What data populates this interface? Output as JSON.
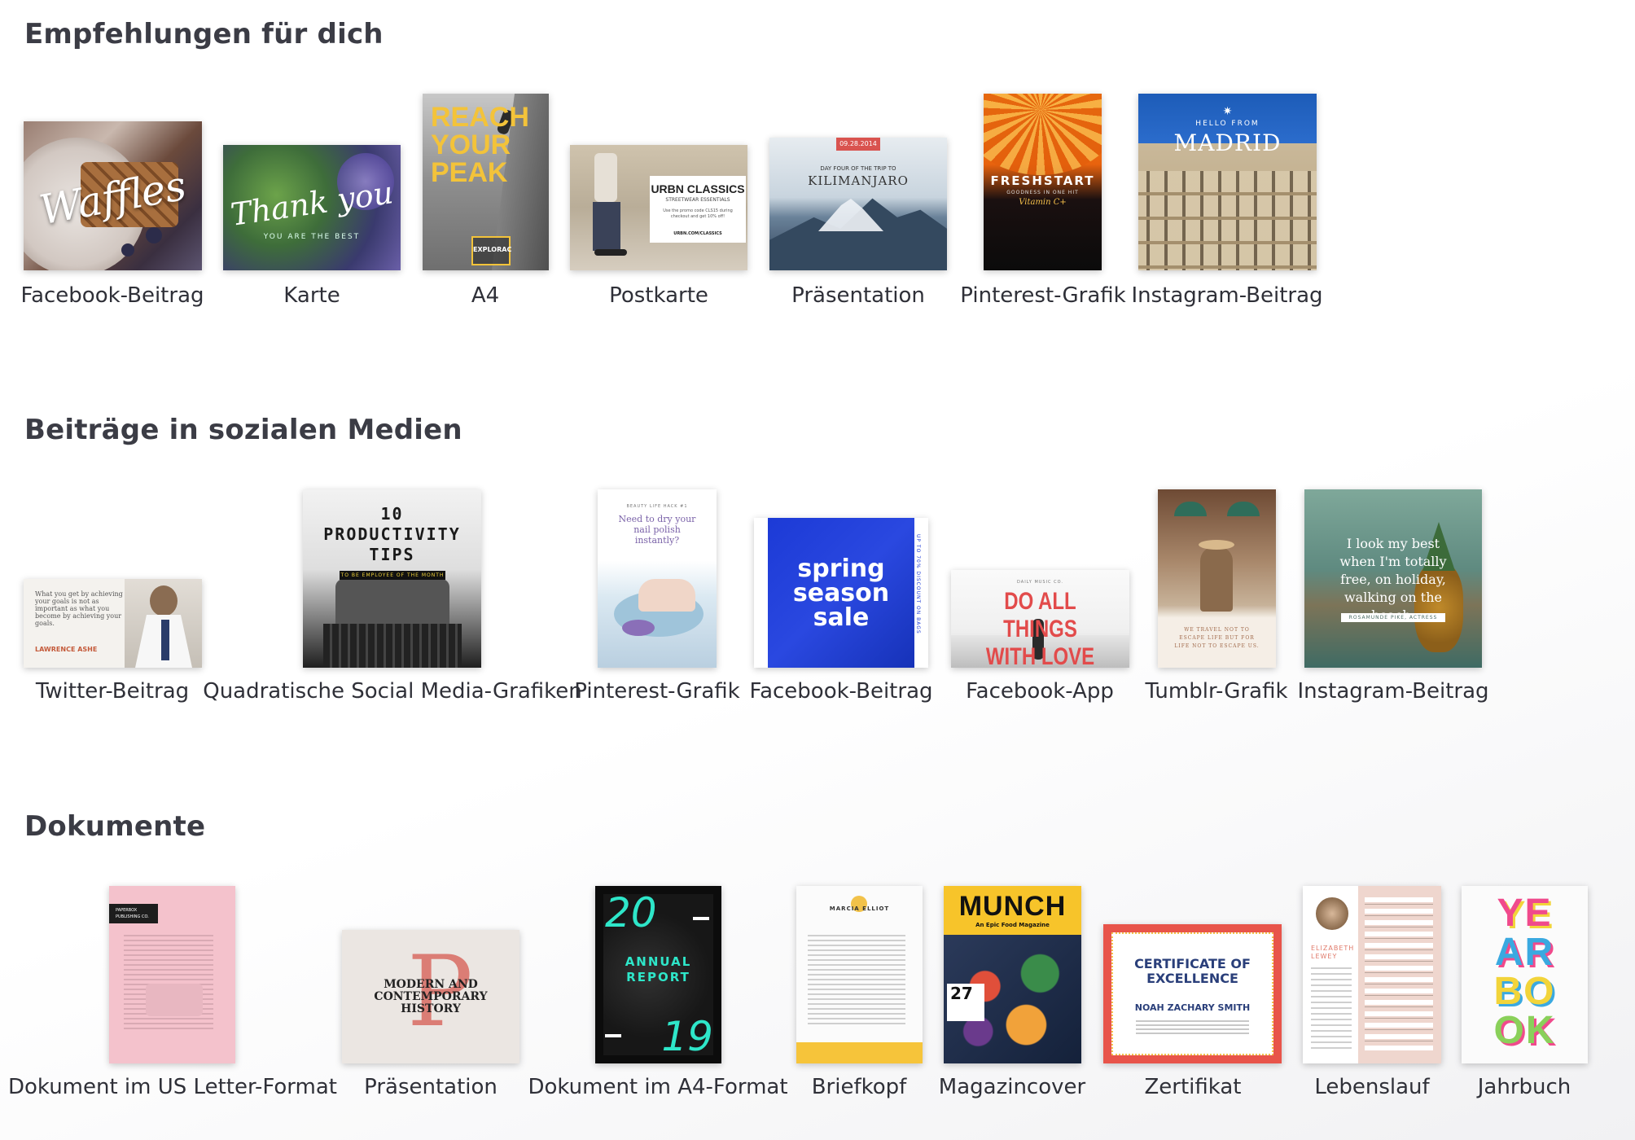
{
  "sections": {
    "recommended": {
      "title": "Empfehlungen für dich",
      "items": [
        {
          "label": "Facebook-Beitrag",
          "thumb_text": "Waffles"
        },
        {
          "label": "Karte",
          "thumb_text": "Thank you",
          "thumb_sub": "YOU ARE THE BEST"
        },
        {
          "label": "A4",
          "thumb_text": [
            "REACH",
            "YOUR",
            "PEAK"
          ],
          "thumb_sub": "EXPLORAC"
        },
        {
          "label": "Postkarte",
          "thumb_text": "URBN CLASSICS",
          "thumb_sub": "STREETWEAR ESSENTIALS",
          "thumb_note": "Use the promo code CLS15 during checkout and get 10% off!",
          "thumb_url": "URBN.COM/CLASSICS"
        },
        {
          "label": "Präsentation",
          "thumb_date": "09.28.2014",
          "thumb_sub": "DAY FOUR OF THE TRIP TO",
          "thumb_text": "KILIMANJARO"
        },
        {
          "label": "Pinterest-Grafik",
          "thumb_text": "FRESHSTART",
          "thumb_sub": "GOODNESS IN ONE HIT",
          "thumb_note": "Vitamin C+"
        },
        {
          "label": "Instagram-Beitrag",
          "thumb_sub": "HELLO FROM",
          "thumb_text": "MADRID"
        }
      ]
    },
    "social": {
      "title": "Beiträge in sozialen Medien",
      "items": [
        {
          "label": "Twitter-Beitrag",
          "thumb_text": "What you get by achieving your goals is not as important as what you become by achieving your goals.",
          "thumb_sub": "LAWRENCE ASHE"
        },
        {
          "label": "Quadratische Social Media-Grafiken",
          "thumb_text": [
            "10",
            "PRODUCTIVITY",
            "TIPS"
          ],
          "thumb_sub": "TO BE EMPLOYEE OF THE MONTH"
        },
        {
          "label": "Pinterest-Grafik",
          "thumb_sub": "BEAUTY LIFE HACK #1",
          "thumb_text": "Need to dry your nail polish instantly?"
        },
        {
          "label": "Facebook-Beitrag",
          "thumb_text": [
            "spring",
            "season",
            "sale"
          ],
          "thumb_sub": "UP TO 70% DISCOUNT ON BAGS"
        },
        {
          "label": "Facebook-App",
          "thumb_sub": "DAILY MUSIC CO.",
          "thumb_text": [
            "DO ALL THINGS",
            "WITH LOVE"
          ]
        },
        {
          "label": "Tumblr-Grafik",
          "thumb_text": "WE TRAVEL NOT TO ESCAPE LIFE BUT FOR LIFE NOT TO ESCAPE US."
        },
        {
          "label": "Instagram-Beitrag",
          "thumb_text": "I look my best when I'm totally free, on holiday, walking on the beach.",
          "thumb_sub": "ROSAMUNDE PIKE, ACTRESS"
        }
      ]
    },
    "documents": {
      "title": "Dokumente",
      "items": [
        {
          "label": "Dokument im US Letter-Format",
          "thumb_text": "PAPERBOX PUBLISHING CO."
        },
        {
          "label": "Präsentation",
          "thumb_text": [
            "MODERN AND",
            "CONTEMPORARY",
            "HISTORY"
          ]
        },
        {
          "label": "Dokument im A4-Format",
          "thumb_text": [
            "20",
            "19"
          ],
          "thumb_sub": [
            "ANNUAL",
            "REPORT"
          ]
        },
        {
          "label": "Briefkopf",
          "thumb_text": "MARCIA ELLIOT"
        },
        {
          "label": "Magazincover",
          "thumb_text": "MUNCH",
          "thumb_sub": "An Epic Food Magazine",
          "thumb_note": "27"
        },
        {
          "label": "Zertifikat",
          "thumb_text": [
            "CERTIFICATE OF",
            "EXCELLENCE"
          ],
          "thumb_sub": "NOAH ZACHARY SMITH"
        },
        {
          "label": "Lebenslauf",
          "thumb_text": [
            "ELIZABETH",
            "LEWEY"
          ]
        },
        {
          "label": "Jahrbuch",
          "thumb_text": [
            "YE",
            "AR",
            "BO",
            "OK"
          ]
        }
      ]
    }
  },
  "colors": {
    "title": "#3b3c45",
    "label": "#2f3038",
    "accent_blue": "#2034c8",
    "accent_red": "#e24b4b"
  }
}
